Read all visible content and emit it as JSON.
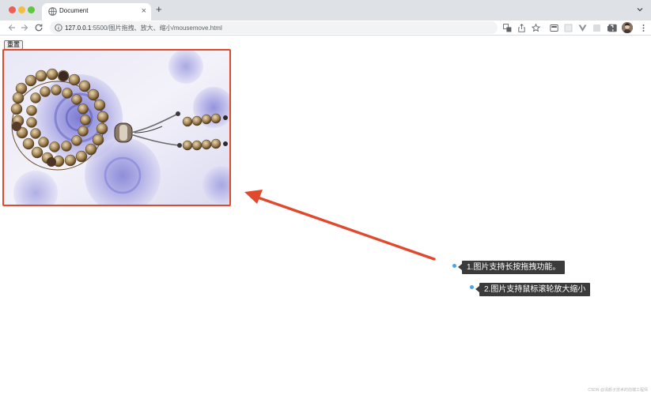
{
  "browser": {
    "tab_title": "Document",
    "new_tab_symbol": "+",
    "close_symbol": "×",
    "address": {
      "host": "127.0.0.1",
      "path": ":5500/图片拖拽、放大、缩小/mousemove.html"
    },
    "icons": {
      "back": "arrow-left-icon",
      "forward": "arrow-right-icon",
      "reload": "reload-icon",
      "info": "info-circle-icon",
      "translate": "translate-icon",
      "share": "share-icon",
      "bookmark": "star-icon",
      "extensions": "puzzle-icon",
      "side_panel": "side-panel-icon",
      "profile": "avatar"
    }
  },
  "page": {
    "reset_button_label": "重置",
    "image": {
      "description_icon": "prayer-beads-photo",
      "border_color": "#e0492c"
    }
  },
  "annotations": {
    "arrow_color": "#e0492c",
    "notes": [
      {
        "text": "1.图片支持长按拖拽功能。"
      },
      {
        "text": "2.图片支持鼠标滚轮放大缩小"
      }
    ]
  },
  "watermark": "CSDN @清颜子技术的前端工程师"
}
